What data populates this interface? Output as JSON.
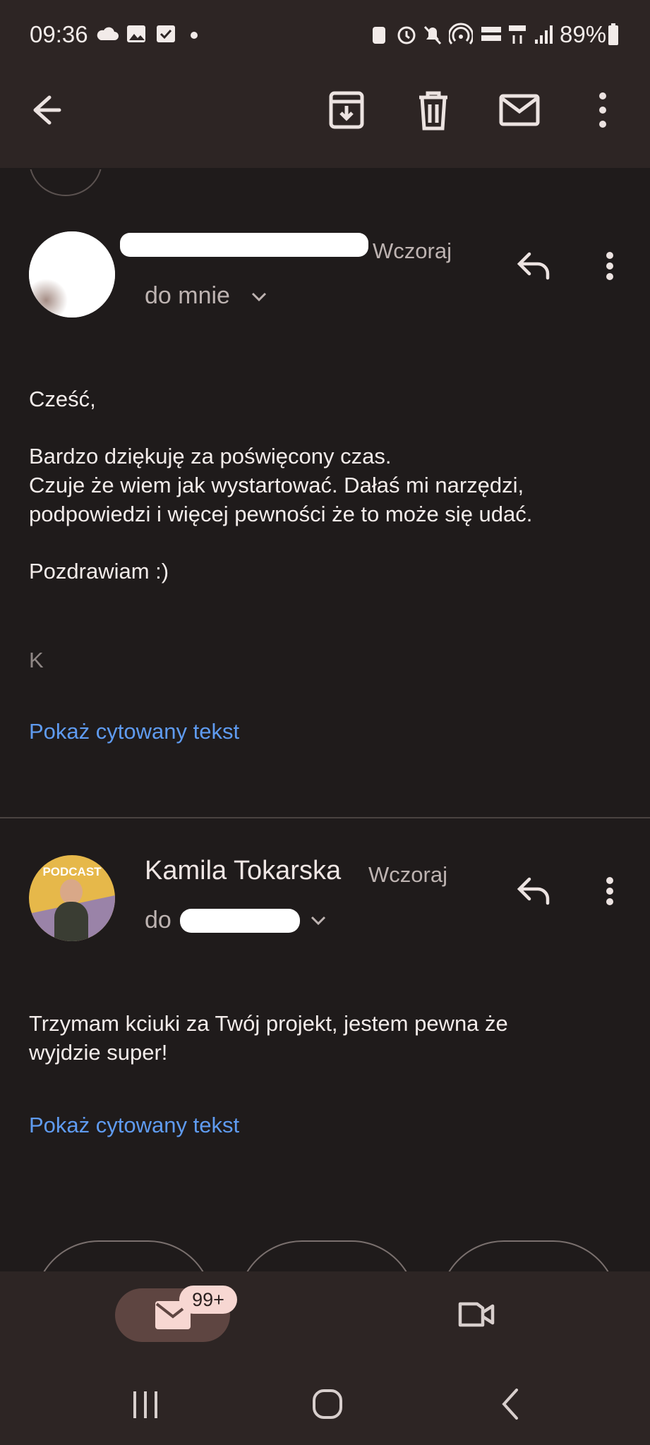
{
  "status_bar": {
    "time": "09:36",
    "battery": "89%"
  },
  "toolbar": {
    "back_icon": "arrow-left-icon",
    "archive_icon": "archive-icon",
    "delete_icon": "trash-icon",
    "mark_unread_icon": "mail-icon",
    "more_icon": "more-vert-icon"
  },
  "messages": [
    {
      "sender": "",
      "time": "Wczoraj",
      "recipient": "do mnie",
      "body": [
        "Cześć,",
        "Bardzo dziękuję za poświęcony czas.",
        "Czuje że wiem jak wystartować. Dałaś mi narzędzi,",
        "podpowiedzi i więcej pewności że to może się udać.",
        "Pozdrawiam :)",
        "K"
      ],
      "quoted_link": "Pokaż cytowany tekst"
    },
    {
      "sender": "Kamila Tokarska",
      "time": "Wczoraj",
      "recipient": "do",
      "avatar_text": "PODCAST",
      "body": [
        "Trzymam kciuki za Twój projekt, jestem pewna że",
        "wyjdzie super!"
      ],
      "quoted_link": "Pokaż cytowany tekst"
    }
  ],
  "bottom_nav": {
    "mail_badge": "99+"
  },
  "colors": {
    "background": "#1f1b1b",
    "bar": "#2d2524",
    "link": "#5f9bf0",
    "badge": "#f7d7d2"
  }
}
